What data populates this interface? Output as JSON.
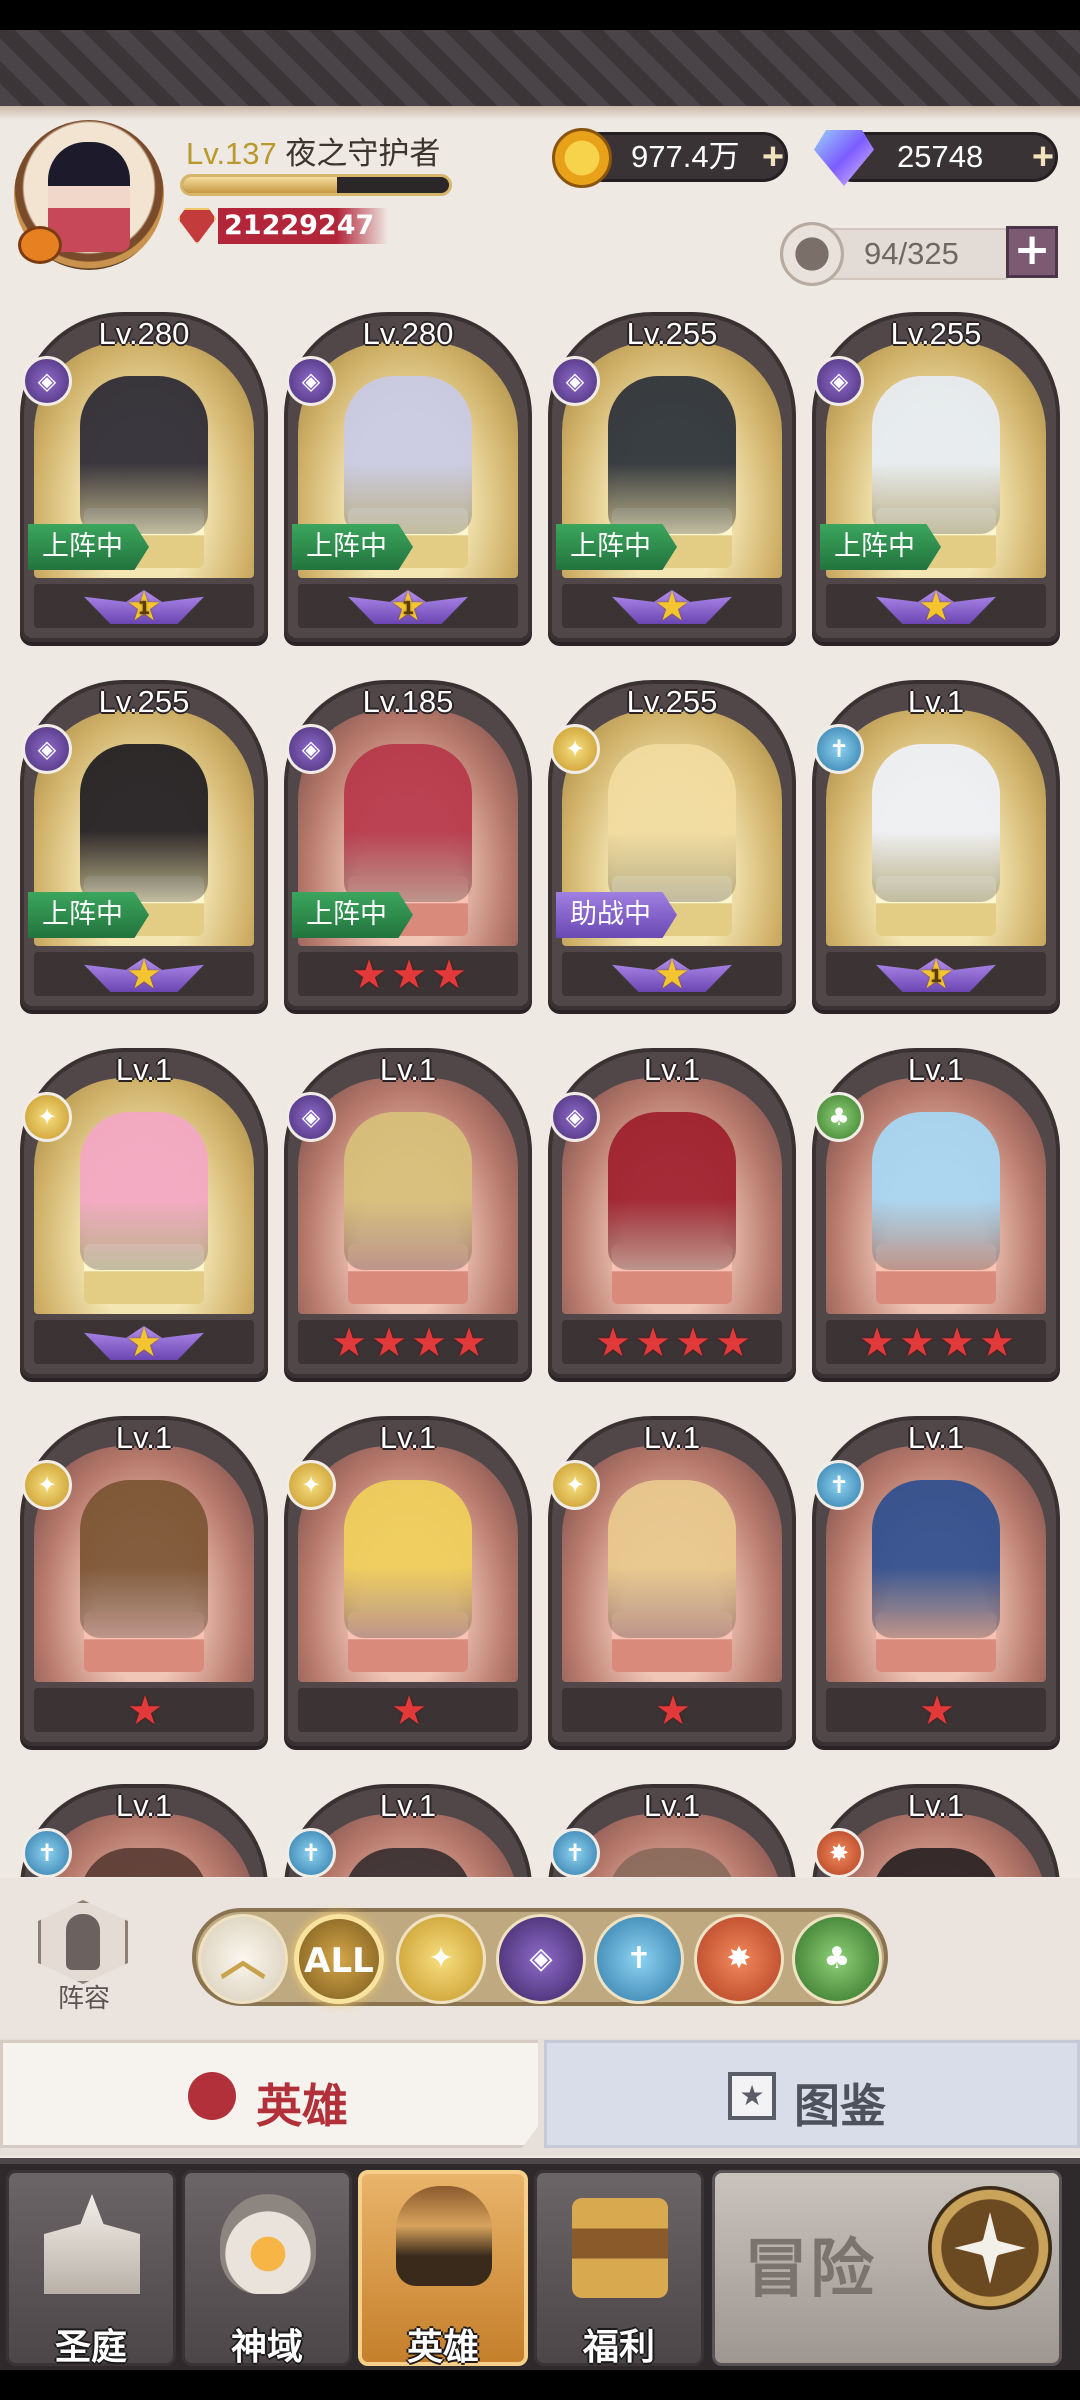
{
  "player": {
    "level_prefix": "Lv.137",
    "name": "夜之守护者",
    "exp_progress": 0.58,
    "power": "21229247"
  },
  "currency": {
    "gold": "977.4万",
    "gems": "25748",
    "plus_symbol": "+"
  },
  "roster": {
    "count": "94/325",
    "plus_symbol": "+"
  },
  "element_icons": {
    "dark": "dark-element-icon",
    "light": "light-element-icon",
    "holy": "holy-cross-element-icon",
    "nature": "nature-tree-element-icon",
    "beast": "beast-wolf-element-icon"
  },
  "heroes": [
    {
      "level": "Lv.280",
      "element": "dark",
      "bg": "gold",
      "status": "上阵中",
      "rank": "wings-1",
      "rank_num": "1",
      "color": "#2c2a35"
    },
    {
      "level": "Lv.280",
      "element": "dark",
      "bg": "gold",
      "status": "上阵中",
      "rank": "wings-1",
      "rank_num": "1",
      "color": "#c9cbe6"
    },
    {
      "level": "Lv.255",
      "element": "dark",
      "bg": "gold",
      "status": "上阵中",
      "rank": "wings-star",
      "rank_num": "",
      "color": "#2b3139"
    },
    {
      "level": "Lv.255",
      "element": "dark",
      "bg": "gold",
      "status": "上阵中",
      "rank": "wings-star",
      "rank_num": "",
      "color": "#e7edf3"
    },
    {
      "level": "Lv.255",
      "element": "dark",
      "bg": "gold",
      "status": "上阵中",
      "rank": "wings-star",
      "rank_num": "",
      "color": "#201d22"
    },
    {
      "level": "Lv.185",
      "element": "dark",
      "bg": "red",
      "status": "上阵中",
      "rank": "stars",
      "stars": 3,
      "color": "#b7384a"
    },
    {
      "level": "Lv.255",
      "element": "light",
      "bg": "gold",
      "status": "助战中",
      "rank": "wings-star",
      "rank_num": "",
      "color": "#f2dca0"
    },
    {
      "level": "Lv.1",
      "element": "holy",
      "bg": "gold",
      "status": "",
      "rank": "wings-1",
      "rank_num": "1",
      "color": "#eef1f7"
    },
    {
      "level": "Lv.1",
      "element": "light",
      "bg": "gold",
      "status": "",
      "rank": "wings-star",
      "rank_num": "",
      "color": "#f3a7c4"
    },
    {
      "level": "Lv.1",
      "element": "dark",
      "bg": "red",
      "status": "",
      "rank": "stars",
      "stars": 4,
      "color": "#d8c07a"
    },
    {
      "level": "Lv.1",
      "element": "dark",
      "bg": "red",
      "status": "",
      "rank": "stars",
      "stars": 4,
      "color": "#9e1f2d"
    },
    {
      "level": "Lv.1",
      "element": "nature",
      "bg": "red",
      "status": "",
      "rank": "stars",
      "stars": 4,
      "color": "#a7d7f4"
    },
    {
      "level": "Lv.1",
      "element": "light",
      "bg": "red",
      "status": "",
      "rank": "stars",
      "stars": 1,
      "color": "#7b5534"
    },
    {
      "level": "Lv.1",
      "element": "light",
      "bg": "red",
      "status": "",
      "rank": "stars",
      "stars": 1,
      "color": "#f0cf5a"
    },
    {
      "level": "Lv.1",
      "element": "light",
      "bg": "red",
      "status": "",
      "rank": "stars",
      "stars": 1,
      "color": "#e9c98e"
    },
    {
      "level": "Lv.1",
      "element": "holy",
      "bg": "red",
      "status": "",
      "rank": "stars",
      "stars": 1,
      "color": "#2f4f8f"
    },
    {
      "level": "Lv.1",
      "element": "holy",
      "bg": "red",
      "status": "",
      "rank": "none",
      "color": "#5a3c34"
    },
    {
      "level": "Lv.1",
      "element": "holy",
      "bg": "red",
      "status": "",
      "rank": "none",
      "color": "#3a3032"
    },
    {
      "level": "Lv.1",
      "element": "holy",
      "bg": "red",
      "status": "",
      "rank": "none",
      "color": "#8a6a5c"
    },
    {
      "level": "Lv.1",
      "element": "beast",
      "bg": "red",
      "status": "",
      "rank": "none",
      "color": "#2b2224"
    }
  ],
  "lineup": {
    "label": "阵容"
  },
  "filters": [
    {
      "key": "up",
      "label": "︿",
      "icon": "collapse-chevron-up-icon"
    },
    {
      "key": "all",
      "label": "ALL",
      "icon": "all-filter-icon"
    },
    {
      "key": "light",
      "label": "",
      "icon": "light-element-icon"
    },
    {
      "key": "dark",
      "label": "",
      "icon": "dark-element-icon"
    },
    {
      "key": "holy",
      "label": "",
      "icon": "holy-cross-element-icon"
    },
    {
      "key": "beast",
      "label": "",
      "icon": "beast-wolf-element-icon"
    },
    {
      "key": "nature",
      "label": "",
      "icon": "nature-tree-element-icon"
    }
  ],
  "section_tabs": {
    "heroes": "英雄",
    "codex": "图鉴"
  },
  "bottom_nav": {
    "courtyard": "圣庭",
    "divine": "神域",
    "heroes": "英雄",
    "welfare": "福利",
    "adventure": "冒险"
  },
  "colors": {
    "accent_gold": "#d4a64a",
    "onteam_green": "#2f8f4f",
    "assist_purple": "#8464cc",
    "star_red": "#e23a3a",
    "star_gold": "#f5c52f"
  }
}
